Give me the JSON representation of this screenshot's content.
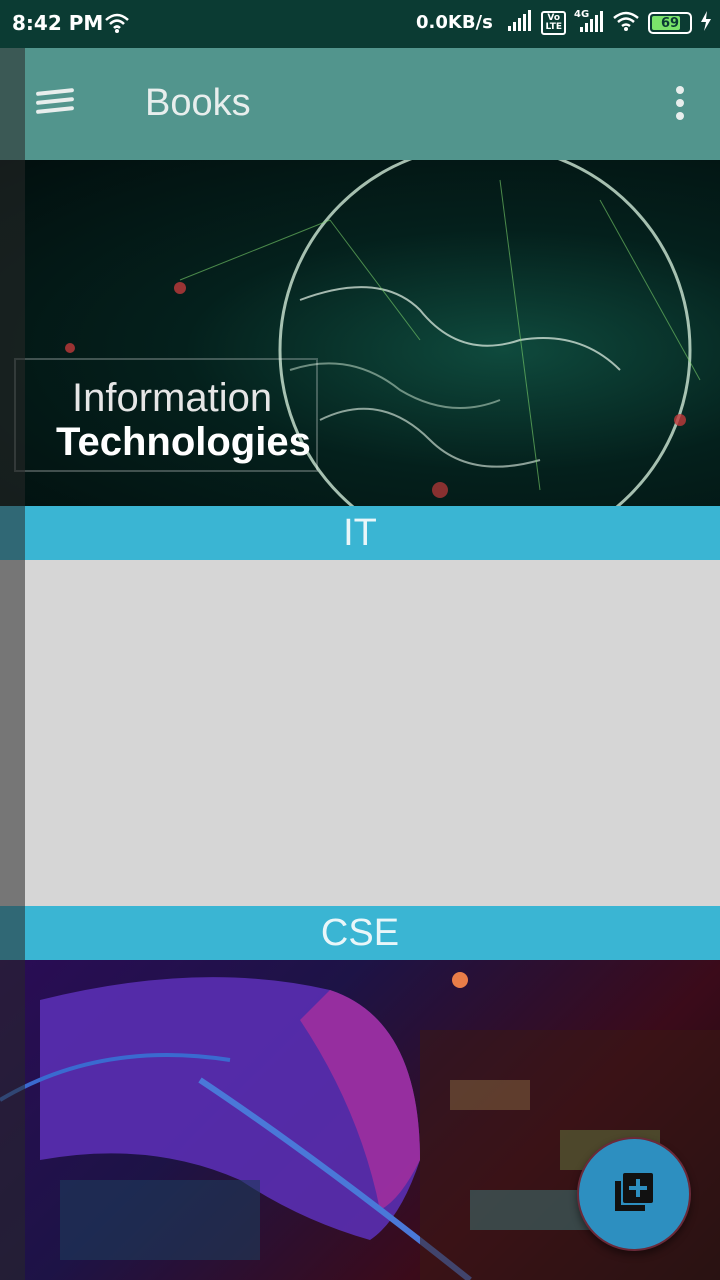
{
  "status_bar": {
    "time": "8:42 PM",
    "network_speed": "0.0KB/s",
    "volte_label": "Vo\nLTE",
    "network_type": "4G",
    "battery_level": "69"
  },
  "app_bar": {
    "title": "Books",
    "menu_icon": "menu-icon",
    "overflow_icon": "more-vert-icon"
  },
  "cards": [
    {
      "image_text_line1": "Information",
      "image_text_line2": "Technologies",
      "label": "IT"
    },
    {
      "label": "CSE"
    }
  ],
  "fab": {
    "icon": "library-add-icon"
  },
  "colors": {
    "status_bar": "#0b3b33",
    "app_bar": "#52958d",
    "label_bar": "#3ab5d3",
    "fab": "#2d8fc0"
  }
}
